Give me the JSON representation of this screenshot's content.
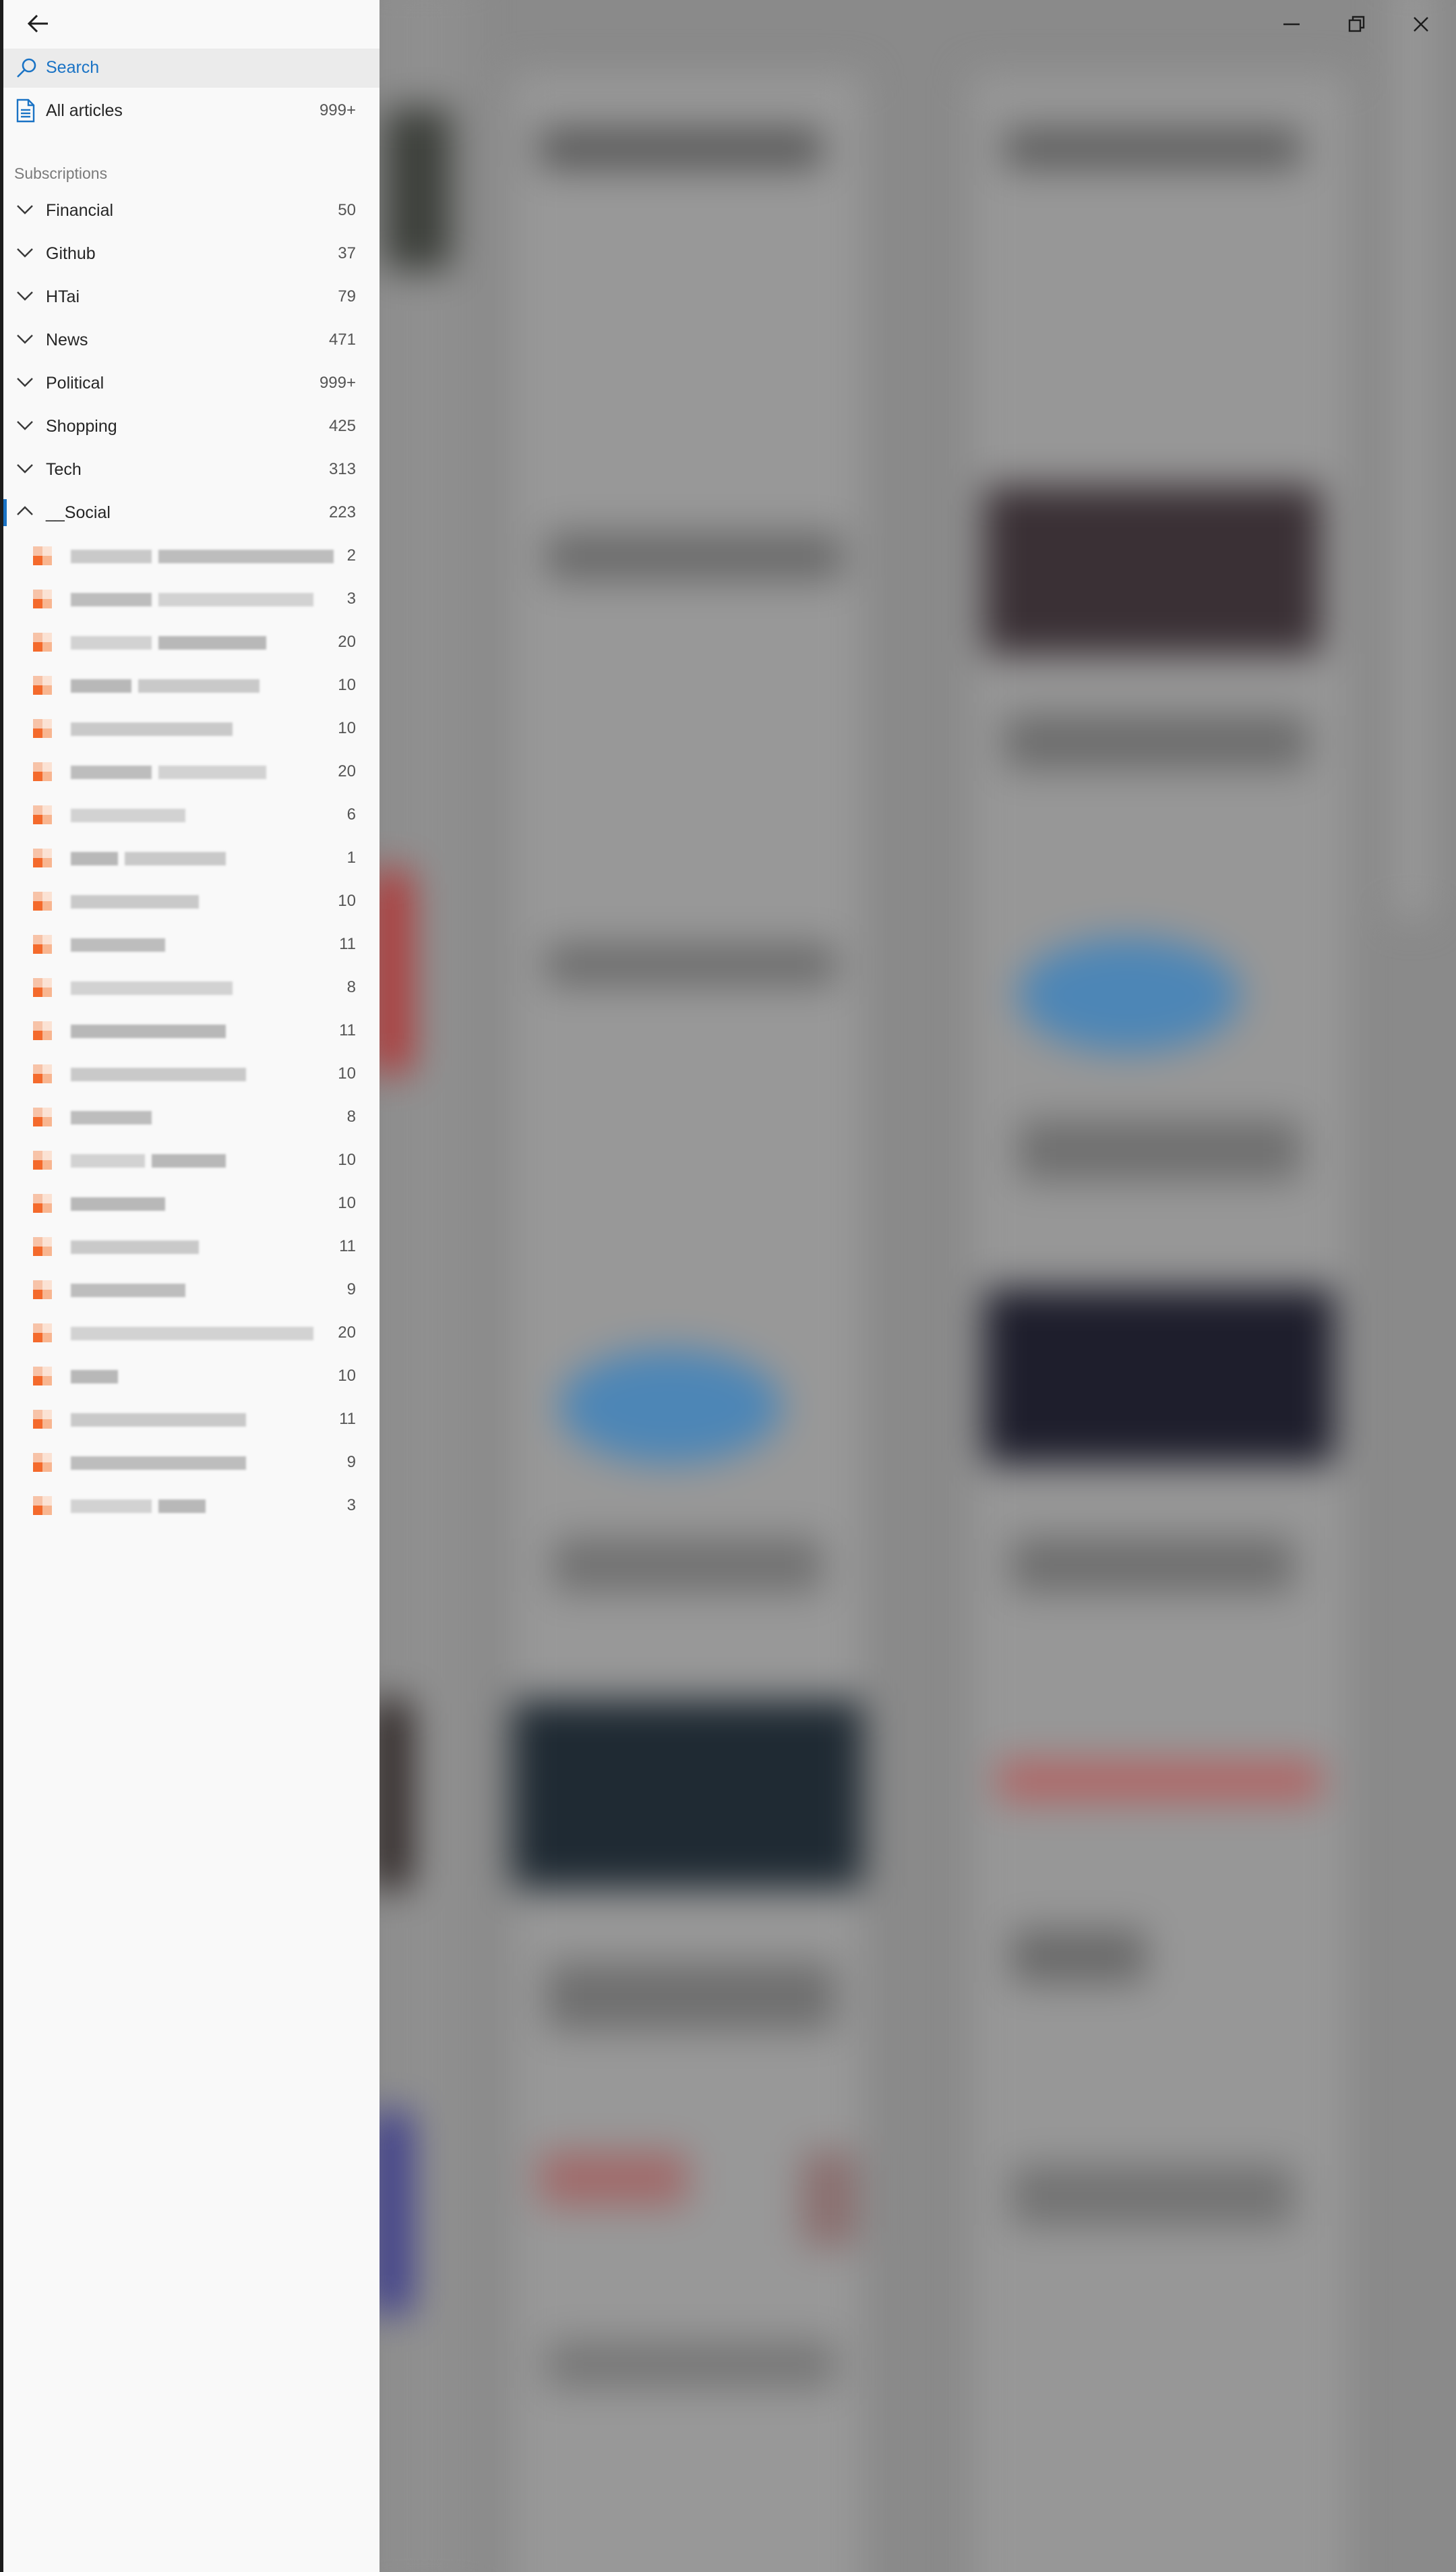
{
  "window": {
    "controls": {
      "minimize": "minimize-icon",
      "restore": "restore-icon",
      "close": "close-icon"
    }
  },
  "sidebar": {
    "back": "back-arrow-icon",
    "search_label": "Search",
    "all_articles": {
      "label": "All articles",
      "count": "999+"
    },
    "subscriptions_header": "Subscriptions",
    "categories": [
      {
        "label": "Financial",
        "count": "50",
        "expanded": false
      },
      {
        "label": "Github",
        "count": "37",
        "expanded": false
      },
      {
        "label": "HTai",
        "count": "79",
        "expanded": false
      },
      {
        "label": "News",
        "count": "471",
        "expanded": false
      },
      {
        "label": "Political",
        "count": "999+",
        "expanded": false
      },
      {
        "label": "Shopping",
        "count": "425",
        "expanded": false
      },
      {
        "label": "Tech",
        "count": "313",
        "expanded": false
      },
      {
        "label": "__Social",
        "count": "223",
        "expanded": true,
        "selected": true
      }
    ],
    "social_feed_counts": [
      "2",
      "3",
      "20",
      "10",
      "10",
      "20",
      "6",
      "1",
      "10",
      "11",
      "8",
      "11",
      "10",
      "8",
      "10",
      "10",
      "11",
      "9",
      "20",
      "10",
      "11",
      "9",
      "3"
    ]
  },
  "colors": {
    "accent": "#1a73c5",
    "sidebar_bg": "#f9f9f9",
    "search_row_bg": "#ebebeb",
    "feed_icon": "#f46a2c",
    "overlay": "#7a7a7a"
  }
}
